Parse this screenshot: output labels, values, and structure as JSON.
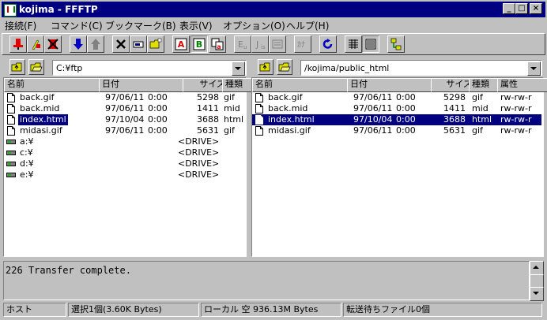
{
  "window": {
    "title": "kojima - FFFTP",
    "minimize": "_",
    "maximize": "□",
    "close": "×"
  },
  "menu": [
    "接続(F)",
    "コマンド(C)",
    "ブックマーク(B)",
    "表示(V)",
    "オプション(O)",
    "ヘルプ(H)"
  ],
  "toolbar": [
    "connect-icon",
    "quick-connect-icon",
    "disconnect-icon",
    "download-icon",
    "upload-icon",
    "delete-icon",
    "rename-icon",
    "mkdir-icon",
    "ascii-mode-icon",
    "binary-mode-icon",
    "auto-mode-icon",
    "euc-icon",
    "jis-icon",
    "no-convert-icon",
    "kana-convert-icon",
    "refresh-icon",
    "list-view-icon",
    "detail-view-icon",
    "sync-dir-icon"
  ],
  "local": {
    "path": "C:¥ftp",
    "headers": [
      "名前",
      "日付",
      "サイズ",
      "種類"
    ],
    "rows": [
      {
        "name": "back.gif",
        "date": "97/06/11",
        "time": "0:00",
        "size": "5298",
        "type": "gif",
        "kind": "file",
        "selected": false
      },
      {
        "name": "back.mid",
        "date": "97/06/11",
        "time": "0:00",
        "size": "1411",
        "type": "mid",
        "kind": "file",
        "selected": false
      },
      {
        "name": "index.html",
        "date": "97/10/04",
        "time": "0:00",
        "size": "3688",
        "type": "html",
        "kind": "file",
        "selected": true
      },
      {
        "name": "midasi.gif",
        "date": "97/06/11",
        "time": "0:00",
        "size": "5631",
        "type": "gif",
        "kind": "file",
        "selected": false
      },
      {
        "name": "a:¥",
        "date": "",
        "time": "",
        "size": "<DRIVE>",
        "type": "",
        "kind": "drive",
        "selected": false
      },
      {
        "name": "c:¥",
        "date": "",
        "time": "",
        "size": "<DRIVE>",
        "type": "",
        "kind": "drive",
        "selected": false
      },
      {
        "name": "d:¥",
        "date": "",
        "time": "",
        "size": "<DRIVE>",
        "type": "",
        "kind": "drive",
        "selected": false
      },
      {
        "name": "e:¥",
        "date": "",
        "time": "",
        "size": "<DRIVE>",
        "type": "",
        "kind": "drive",
        "selected": false
      }
    ]
  },
  "remote": {
    "path": "/kojima/public_html",
    "headers": [
      "名前",
      "日付",
      "サイズ",
      "種類",
      "属性"
    ],
    "rows": [
      {
        "name": "back.gif",
        "date": "97/06/11",
        "time": "0:00",
        "size": "5298",
        "type": "gif",
        "attr": "rw-rw-r",
        "selected": false
      },
      {
        "name": "back.mid",
        "date": "97/06/11",
        "time": "0:00",
        "size": "1411",
        "type": "mid",
        "attr": "rw-rw-r",
        "selected": false
      },
      {
        "name": "index.html",
        "date": "97/10/04",
        "time": "0:00",
        "size": "3688",
        "type": "html",
        "attr": "rw-rw-r",
        "selected": true
      },
      {
        "name": "midasi.gif",
        "date": "97/06/11",
        "time": "0:00",
        "size": "5631",
        "type": "gif",
        "attr": "rw-rw-r",
        "selected": false
      }
    ]
  },
  "log": {
    "text": "226 Transfer complete."
  },
  "status": {
    "host": "ホスト",
    "selection": "選択1個(3.60K Bytes)",
    "local_free": "ローカル 空 936.13M Bytes",
    "queue": "転送待ちファイル0個"
  },
  "colors": {
    "title_bar": "#000080",
    "selection": "#000080",
    "face": "#c0c0c0"
  }
}
